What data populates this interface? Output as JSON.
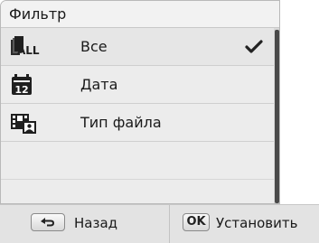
{
  "header": {
    "title": "Фильтр"
  },
  "filter_options": [
    {
      "label": "Все",
      "icon": "all-icon",
      "selected": true
    },
    {
      "label": "Дата",
      "icon": "calendar-icon",
      "selected": false
    },
    {
      "label": "Тип файла",
      "icon": "file-type-icon",
      "selected": false
    }
  ],
  "footer": {
    "back_key": "",
    "back_label": "Назад",
    "set_key": "OK",
    "set_label": "Установить"
  },
  "icon_all_text": "ALL",
  "icon_date_text": "12",
  "colors": {
    "text": "#1a1a1a",
    "panel": "#ededed",
    "bottom": "#e3e3e3",
    "thumb": "#4a4a4a"
  }
}
